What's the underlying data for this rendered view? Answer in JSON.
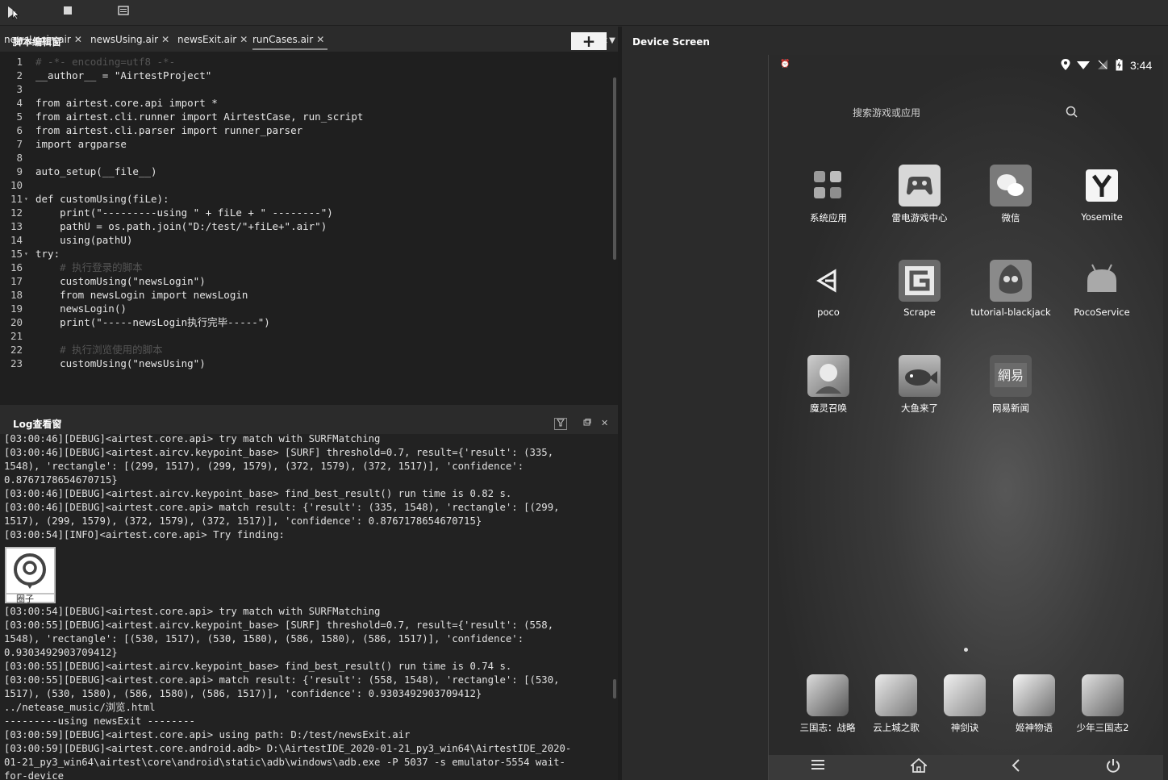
{
  "toolbar": {
    "run_icon": "play-icon",
    "stop_icon": "stop-icon",
    "menu_icon": "list-icon"
  },
  "script_panel": {
    "title": "脚本编辑窗",
    "tabs": [
      {
        "label": "newsLogin.air",
        "close": "✕"
      },
      {
        "label": "newsUsing.air",
        "close": "✕"
      },
      {
        "label": "newsExit.air",
        "close": "✕"
      },
      {
        "label": "runCases.air",
        "close": "✕"
      }
    ],
    "add_label": "+"
  },
  "code_lines": [
    {
      "n": "1",
      "text": "# -*- encoding=utf8 -*-"
    },
    {
      "n": "2",
      "text": "__author__ = \"AirtestProject\""
    },
    {
      "n": "3",
      "text": ""
    },
    {
      "n": "4",
      "text": "from airtest.core.api import *"
    },
    {
      "n": "5",
      "text": "from airtest.cli.runner import AirtestCase, run_script"
    },
    {
      "n": "6",
      "text": "from airtest.cli.parser import runner_parser"
    },
    {
      "n": "7",
      "text": "import argparse"
    },
    {
      "n": "8",
      "text": ""
    },
    {
      "n": "9",
      "text": "auto_setup(__file__)"
    },
    {
      "n": "10",
      "text": ""
    },
    {
      "n": "11",
      "text": "def customUsing(fiLe):"
    },
    {
      "n": "12",
      "text": "    print(\"---------using \" + fiLe + \" --------\")"
    },
    {
      "n": "13",
      "text": "    pathU = os.path.join(\"D:/test/\"+fiLe+\".air\")"
    },
    {
      "n": "14",
      "text": "    using(pathU)"
    },
    {
      "n": "15",
      "text": "try:"
    },
    {
      "n": "16",
      "text": "    # 执行登录的脚本"
    },
    {
      "n": "17",
      "text": "    customUsing(\"newsLogin\")"
    },
    {
      "n": "18",
      "text": "    from newsLogin import newsLogin"
    },
    {
      "n": "19",
      "text": "    newsLogin()"
    },
    {
      "n": "20",
      "text": "    print(\"-----newsLogin执行完毕-----\")"
    },
    {
      "n": "21",
      "text": ""
    },
    {
      "n": "22",
      "text": "    # 执行浏览使用的脚本"
    },
    {
      "n": "23",
      "text": "    customUsing(\"newsUsing\")"
    }
  ],
  "log_panel": {
    "title": "Log查看窗",
    "lines_top": [
      "[03:00:46][DEBUG]<airtest.core.api> try match with SURFMatching",
      "[03:00:46][DEBUG]<airtest.aircv.keypoint_base> [SURF] threshold=0.7, result={'result': (335,",
      "1548), 'rectangle': [(299, 1517), (299, 1579), (372, 1579), (372, 1517)], 'confidence':",
      "0.8767178654670715}",
      "[03:00:46][DEBUG]<airtest.aircv.keypoint_base> find_best_result() run time is 0.82 s.",
      "[03:00:46][DEBUG]<airtest.core.api> match result: {'result': (335, 1548), 'rectangle': [(299,",
      "1517), (299, 1579), (372, 1579), (372, 1517)], 'confidence': 0.8767178654670715}",
      "[03:00:54][INFO]<airtest.core.api> Try finding:"
    ],
    "lines_bottom": [
      "[03:00:54][DEBUG]<airtest.core.api> try match with SURFMatching",
      "[03:00:55][DEBUG]<airtest.aircv.keypoint_base> [SURF] threshold=0.7, result={'result': (558,",
      "1548), 'rectangle': [(530, 1517), (530, 1580), (586, 1580), (586, 1517)], 'confidence':",
      "0.9303492903709412}",
      "[03:00:55][DEBUG]<airtest.aircv.keypoint_base> find_best_result() run time is 0.74 s.",
      "[03:00:55][DEBUG]<airtest.core.api> match result: {'result': (558, 1548), 'rectangle': [(530,",
      "1517), (530, 1580), (586, 1580), (586, 1517)], 'confidence': 0.9303492903709412}",
      "../netease_music/浏览.html",
      "---------using newsExit --------",
      "[03:00:59][DEBUG]<airtest.core.api> using path: D:/test/newsExit.air",
      "[03:00:59][DEBUG]<airtest.core.android.adb> D:\\AirtestIDE_2020-01-21_py3_win64\\AirtestIDE_2020-",
      "01-21_py3_win64\\airtest\\core\\android\\static\\adb\\windows\\adb.exe -P 5037 -s emulator-5554 wait-",
      "for-device"
    ],
    "thumb_caption": "圈子"
  },
  "device_panel": {
    "title": "Device Screen",
    "time": "3:44",
    "search_placeholder": "搜索游戏或应用",
    "apps": [
      {
        "label": "系统应用",
        "icon": "system-apps-icon"
      },
      {
        "label": "雷电游戏中心",
        "icon": "gamepad-icon"
      },
      {
        "label": "微信",
        "icon": "wechat-icon"
      },
      {
        "label": "Yosemite",
        "icon": "yosemite-icon"
      },
      {
        "label": "poco",
        "icon": "unity-icon"
      },
      {
        "label": "Scrape",
        "icon": "scrape-icon"
      },
      {
        "label": "tutorial-blackjack",
        "icon": "blackjack-icon"
      },
      {
        "label": "PocoService",
        "icon": "android-icon"
      },
      {
        "label": "魔灵召唤",
        "icon": "summoners-war-icon"
      },
      {
        "label": "大鱼来了",
        "icon": "big-fish-icon"
      },
      {
        "label": "网易新闻",
        "icon": "netease-news-icon"
      }
    ],
    "dock": [
      {
        "label": "三国志：战略",
        "icon": "sanguo-icon"
      },
      {
        "label": "云上城之歌",
        "icon": "cloud-city-icon"
      },
      {
        "label": "神剑诀",
        "icon": "sword-icon"
      },
      {
        "label": "姬神物语",
        "icon": "goddess-icon"
      },
      {
        "label": "少年三国志2",
        "icon": "young-sanguo-icon"
      }
    ]
  }
}
